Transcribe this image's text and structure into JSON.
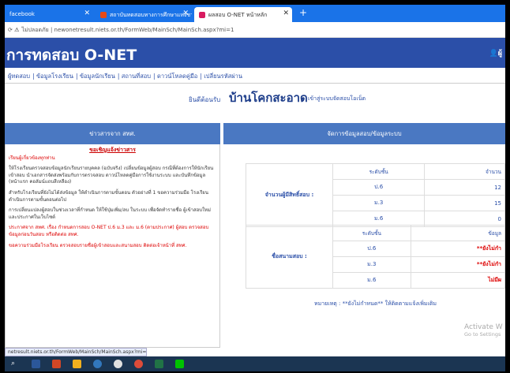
{
  "browser": {
    "tabs": [
      {
        "label": "facebook",
        "active": false,
        "color": "#ffffff"
      },
      {
        "label": "สถาบันทดสอบทางการศึกษาแห่งชาติ (",
        "active": false,
        "color": "#e64a19"
      },
      {
        "label": "ผลสอบ O-NET หน้าหลัก",
        "active": true,
        "color": "#d81b60"
      }
    ],
    "newtab_icon": "plus-icon",
    "address": {
      "prefix": "ไม่ปลอดภัย",
      "url": "newonetresult.niets.or.th/FormWeb/MainSch/MainSch.aspx?mi=1"
    }
  },
  "header": {
    "title": "การทดสอบ O-NET",
    "user_icon": "user-icon",
    "user_label": "ผู้"
  },
  "nav": [
    "ผู้ทดสอบ",
    "ข้อมูลโรงเรียน",
    "ข้อมูลนักเรียน",
    "สถานที่สอบ",
    "ดาวน์โหลดคู่มือ",
    "เปลี่ยนรหัสผ่าน"
  ],
  "welcome": {
    "pre": "ยินดีต้อนรับ",
    "school": "บ้านโคกสะอาด",
    "post": "เข้าสู่ระบบจัดสอบโอเน็ต"
  },
  "news": {
    "heading": "ข่าวสารจาก สทศ.",
    "title": "ขอเชิญแจ้งข่าวสาร",
    "paragraphs": [
      {
        "text": "เรียนผู้เกี่ยวข้องทุกท่าน",
        "red": true
      },
      {
        "text": "ให้โรงเรียนตรวจสอบข้อมูลนักเรียนรายบุคคล (ฉบับจริง) เปลี่ยนข้อมูลผู้สอบ กรณีที่ต้องการให้นักเรียนเข้าสอบ นำเอกสารจัดส่งพร้อมกับการตรวจสอบ ดาวน์โหลดคู่มือการใช้งานระบบ และบันทึกข้อมูล (หน้าแรก คอลัมน์แถบสีเหลือง)",
        "red": false
      },
      {
        "text": "สำหรับโรงเรียนที่ยังไม่ได้ส่งข้อมูล ให้ดำเนินการตามขั้นตอน ตัวอย่างที่ 1 ขอความร่วมมือ โรงเรียนดำเนินการตามขั้นตอนต่อไป",
        "red": false
      },
      {
        "text": "การเปลี่ยนแปลงผู้สอบในช่วงเวลาที่กำหนด ให้ใช้ปุ่มเพิ่ม/ลบ ในระบบ เพื่อจัดทำรายชื่อ ผู้เข้าสอบใหม่ และประกาศในเว็บไซต์",
        "red": false
      },
      {
        "text": "ประกาศจาก สทศ. เรื่อง กำหนดการสอบ O-NET ป.6 ม.3 และ ม.6 (ตามประกาศ) ผู้สอบ ตรวจสอบข้อมูลก่อนวันสอบ หรือติดต่อ สทศ.",
        "red": true
      },
      {
        "text": "ขอความร่วมมือโรงเรียน ตรวจสอบรายชื่อผู้เข้าสอบและสนามสอบ ติดต่อเจ้าหน้าที่ สทศ.",
        "red": true
      }
    ]
  },
  "status_url": "netresult.niets.or.th/FormWeb/MainSch/MainSch.aspx?mi=1",
  "panel": {
    "heading": "จัดการข้อมูลสอบ/ข้อมูลระบบ",
    "table1": {
      "label": "จำนวนผู้มีสิทธิ์สอบ :",
      "col1": "ระดับชั้น",
      "col2": "จำนวน",
      "rows": [
        {
          "level": "ป.6",
          "value": "12"
        },
        {
          "level": "ม.3",
          "value": "15"
        },
        {
          "level": "ม.6",
          "value": "0"
        }
      ]
    },
    "table2": {
      "label": "ชื่อสนามสอบ :",
      "col1": "ระดับชั้น",
      "col2": "ข้อมูล",
      "rows": [
        {
          "level": "ป.6",
          "value": "**ยังไม่กำ"
        },
        {
          "level": "ม.3",
          "value": "**ยังไม่กำ"
        },
        {
          "level": "ม.6",
          "value": "ไม่มีผ"
        }
      ]
    },
    "note": "หมายเหตุ : **ยังไม่กำหนด** ให้ติดตามแจ้งเพิ่มเติม"
  },
  "windows_notice": {
    "title": "Activate W",
    "sub": "Go to Settings"
  },
  "taskbar_icons": [
    {
      "name": "search-icon",
      "color": "#ffffff"
    },
    {
      "name": "word-icon",
      "color": "#2b579a"
    },
    {
      "name": "powerpoint-icon",
      "color": "#d24726"
    },
    {
      "name": "files-icon",
      "color": "#f2b01e"
    },
    {
      "name": "edge-icon",
      "color": "#3277bc"
    },
    {
      "name": "chrome-icon",
      "color": "#e0e0e0"
    },
    {
      "name": "chrome2-icon",
      "color": "#dd4b39"
    },
    {
      "name": "excel-icon",
      "color": "#217346"
    },
    {
      "name": "line-icon",
      "color": "#00c300"
    }
  ]
}
